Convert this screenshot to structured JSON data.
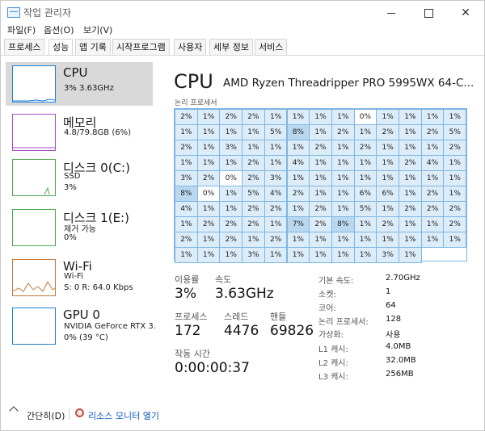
{
  "window": {
    "title": "작업 관리자"
  },
  "menu": [
    "파일(F)",
    "옵션(O)",
    "보기(V)"
  ],
  "tabs": [
    "프로세스",
    "성능",
    "앱 기록",
    "시작프로그램",
    "사용자",
    "세부 정보",
    "서비스"
  ],
  "active_tab": "성능",
  "sidebar": [
    {
      "title": "CPU",
      "lines": [
        "3% 3.63GHz"
      ],
      "color": "#1e7fd1"
    },
    {
      "title": "메모리",
      "lines": [
        "4.8/79.8GB (6%)"
      ],
      "color": "#a64dc2"
    },
    {
      "title": "디스크 0(C:)",
      "lines": [
        "SSD",
        "3%"
      ],
      "color": "#4da64d"
    },
    {
      "title": "디스크 1(E:)",
      "lines": [
        "제거 가능",
        "0%"
      ],
      "color": "#4da64d"
    },
    {
      "title": "Wi-Fi",
      "lines": [
        "Wi-Fi",
        "S: 0  R: 64.0 Kbps"
      ],
      "color": "#c77a3a"
    },
    {
      "title": "GPU 0",
      "lines": [
        "NVIDIA GeForce RTX 3.",
        "0% (39 °C)"
      ],
      "color": "#1e7fd1"
    }
  ],
  "main": {
    "heading": "CPU",
    "model": "AMD Ryzen Threadripper PRO 5995WX 64-C...",
    "grid_label": "논리 프로세서",
    "cores": [
      [
        "2%",
        "1%",
        "2%",
        "2%",
        "1%",
        "1%",
        "1%",
        "1%",
        "0%",
        "1%",
        "1%",
        "1%",
        "1%"
      ],
      [
        "1%",
        "1%",
        "1%",
        "1%",
        "5%",
        "8%",
        "1%",
        "2%",
        "1%",
        "2%",
        "1%",
        "2%",
        "5%"
      ],
      [
        "2%",
        "1%",
        "3%",
        "1%",
        "1%",
        "1%",
        "2%",
        "1%",
        "2%",
        "1%",
        "1%",
        "1%",
        "2%"
      ],
      [
        "1%",
        "1%",
        "1%",
        "2%",
        "1%",
        "4%",
        "1%",
        "1%",
        "1%",
        "1%",
        "2%",
        "4%",
        "1%"
      ],
      [
        "3%",
        "2%",
        "0%",
        "2%",
        "3%",
        "1%",
        "1%",
        "1%",
        "1%",
        "1%",
        "1%",
        "1%",
        "1%"
      ],
      [
        "8%",
        "0%",
        "1%",
        "5%",
        "4%",
        "2%",
        "1%",
        "1%",
        "6%",
        "6%",
        "1%",
        "2%",
        "1%"
      ],
      [
        "4%",
        "1%",
        "1%",
        "2%",
        "2%",
        "1%",
        "2%",
        "1%",
        "5%",
        "1%",
        "2%",
        "2%",
        "2%"
      ],
      [
        "1%",
        "2%",
        "2%",
        "2%",
        "1%",
        "7%",
        "2%",
        "8%",
        "1%",
        "2%",
        "1%",
        "1%",
        "2%"
      ],
      [
        "2%",
        "1%",
        "2%",
        "1%",
        "2%",
        "1%",
        "1%",
        "1%",
        "1%",
        "1%",
        "1%",
        "1%",
        "1%"
      ],
      [
        "1%",
        "1%",
        "1%",
        "3%",
        "1%",
        "1%",
        "1%",
        "1%",
        "1%",
        "3%",
        "1%"
      ]
    ],
    "stats": {
      "usage_label": "이용률",
      "usage_value": "3%",
      "speed_label": "속도",
      "speed_value": "3.63GHz",
      "processes_label": "프로세스",
      "processes_value": "172",
      "threads_label": "스레드",
      "threads_value": "4476",
      "handles_label": "핸들",
      "handles_value": "69826",
      "uptime_label": "작동 시간",
      "uptime_value": "0:00:00:37"
    },
    "specs": [
      {
        "label": "기본 속도:",
        "value": "2.70GHz"
      },
      {
        "label": "소켓:",
        "value": "1"
      },
      {
        "label": "코어:",
        "value": "64"
      },
      {
        "label": "논리 프로세서:",
        "value": "128"
      },
      {
        "label": "가상화:",
        "value": "사용"
      },
      {
        "label": "L1 캐시:",
        "value": "4.0MB"
      },
      {
        "label": "L2 캐시:",
        "value": "32.0MB"
      },
      {
        "label": "L3 캐시:",
        "value": "256MB"
      }
    ]
  },
  "footer": {
    "collapse": "간단히(D)",
    "monitor": "리소스 모니터 열기"
  }
}
